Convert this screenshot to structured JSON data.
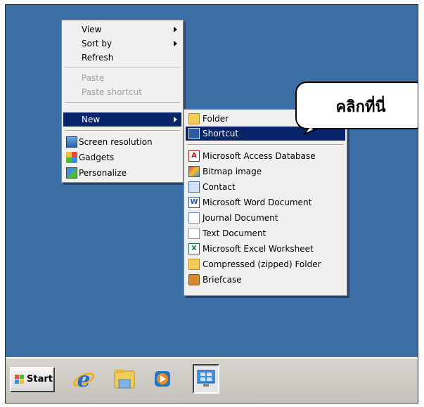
{
  "context_menu": {
    "items": [
      {
        "label": "View",
        "submenu": true,
        "enabled": true
      },
      {
        "label": "Sort by",
        "submenu": true,
        "enabled": true
      },
      {
        "label": "Refresh",
        "submenu": false,
        "enabled": true
      },
      {
        "label": "Paste",
        "submenu": false,
        "enabled": false
      },
      {
        "label": "Paste shortcut",
        "submenu": false,
        "enabled": false
      },
      {
        "label": "New",
        "submenu": true,
        "enabled": true,
        "highlighted": true
      },
      {
        "label": "Screen resolution",
        "icon": "screen-resolution-icon"
      },
      {
        "label": "Gadgets",
        "icon": "gadgets-icon"
      },
      {
        "label": "Personalize",
        "icon": "personalize-icon"
      }
    ]
  },
  "new_submenu": {
    "items": [
      {
        "label": "Folder",
        "icon": "folder-icon"
      },
      {
        "label": "Shortcut",
        "icon": "shortcut-icon",
        "highlighted": true
      },
      {
        "label": "Microsoft Access Database",
        "icon": "access-icon",
        "glyph": "A"
      },
      {
        "label": "Bitmap image",
        "icon": "bitmap-icon"
      },
      {
        "label": "Contact",
        "icon": "contact-icon"
      },
      {
        "label": "Microsoft Word Document",
        "icon": "word-icon",
        "glyph": "W"
      },
      {
        "label": "Journal Document",
        "icon": "journal-icon"
      },
      {
        "label": "Text Document",
        "icon": "text-document-icon"
      },
      {
        "label": "Microsoft Excel Worksheet",
        "icon": "excel-icon",
        "glyph": "X"
      },
      {
        "label": "Compressed (zipped) Folder",
        "icon": "zip-folder-icon"
      },
      {
        "label": "Briefcase",
        "icon": "briefcase-icon"
      }
    ]
  },
  "callout": {
    "text": "คลิกที่นี่"
  },
  "taskbar": {
    "start_label": "Start",
    "items": [
      "internet-explorer-icon",
      "windows-explorer-icon",
      "media-player-icon",
      "desktop-preview-icon"
    ]
  },
  "colors": {
    "desktop": "#3a6ea5",
    "highlight": "#0a246a",
    "menu": "#f0f0ee"
  }
}
